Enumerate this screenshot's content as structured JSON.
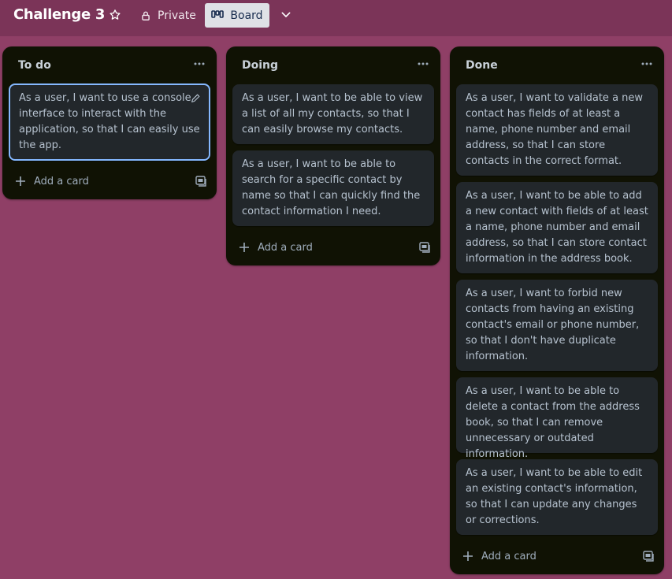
{
  "header": {
    "board_title": "Challenge 3",
    "visibility_label": "Private",
    "view_label": "Board"
  },
  "lists": [
    {
      "title": "To do",
      "cards": [
        {
          "text": "As a user, I want to use a console interface to interact with the application, so that I can easily use the app."
        }
      ],
      "add_label": "Add a card"
    },
    {
      "title": "Doing",
      "cards": [
        {
          "text": "As a user, I want to be able to view a list of all my contacts, so that I can easily browse my contacts."
        },
        {
          "text": "As a user, I want to be able to search for a specific contact by name so that I can quickly find the contact information I need."
        }
      ],
      "add_label": "Add a card"
    },
    {
      "title": "Done",
      "cards": [
        {
          "text": "As a user, I want to validate a new contact has fields of at least a name, phone number and email address, so that I can store contacts in the correct format."
        },
        {
          "text": "As a user, I want to be able to add a new contact with fields of at least a name, phone number and email address, so that I can store contact information in the address book."
        },
        {
          "text": "As a user, I want to forbid new contacts from having an existing contact's email or phone number, so that I don't have duplicate information."
        },
        {
          "text": "As a user, I want to be able to delete a contact from the address book, so that I can remove unnecessary or outdated information."
        },
        {
          "text": "As a user, I want to be able to edit an existing contact's information, so that I can update any changes or corrections."
        }
      ],
      "add_label": "Add a card"
    }
  ],
  "colors": {
    "board_background": "#8f3f66",
    "header_background": "#7b3458",
    "list_background": "#101204",
    "card_background": "#22272b",
    "focus_ring": "#85b8ff"
  },
  "icons": {
    "star": "star-icon",
    "lock": "lock-icon",
    "board": "board-icon",
    "chevron": "chevron-down-icon",
    "more": "more-icon",
    "plus": "plus-icon",
    "template": "card-template-icon",
    "edit": "pencil-icon"
  }
}
